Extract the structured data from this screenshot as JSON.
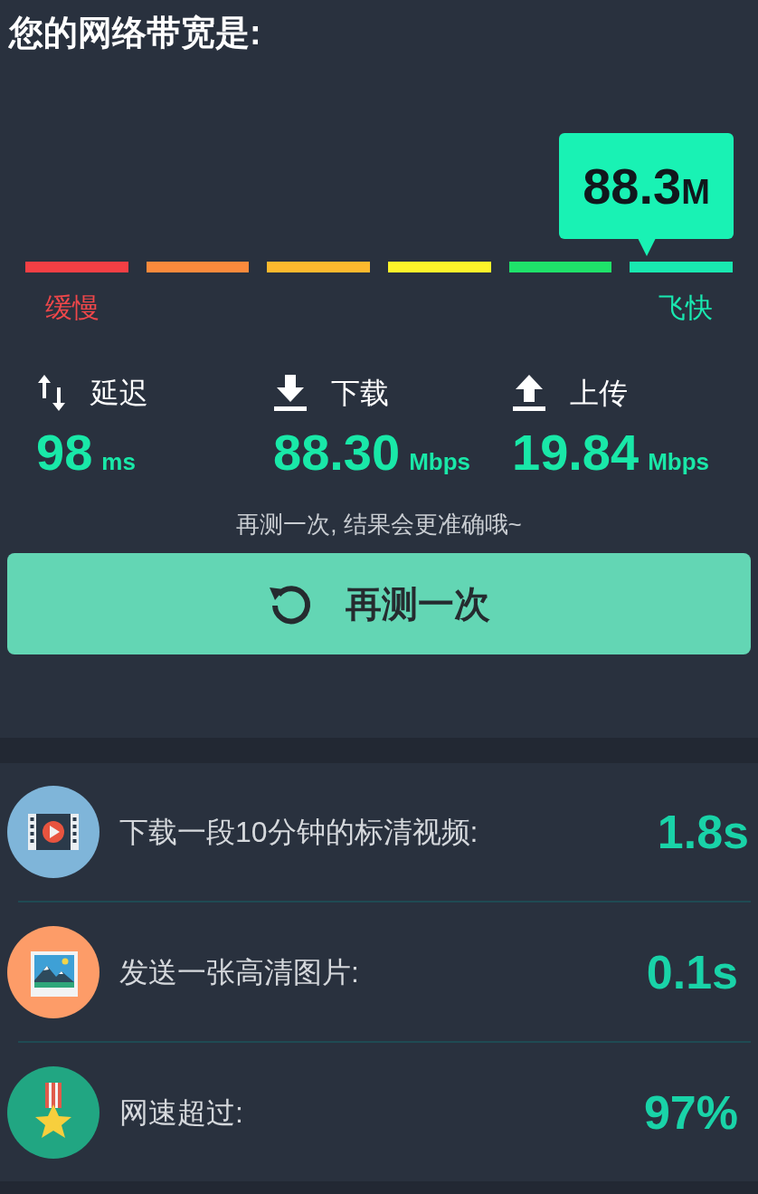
{
  "title": "您的网络带宽是:",
  "gauge": {
    "reading": "88.3",
    "unit": "M",
    "slow_label": "缓慢",
    "fast_label": "飞快",
    "segments": [
      {
        "color": "#f43f44",
        "selected": false
      },
      {
        "color": "#fb8a3c",
        "selected": false
      },
      {
        "color": "#fdb92e",
        "selected": false
      },
      {
        "color": "#fdf32a",
        "selected": false
      },
      {
        "color": "#1fe26a",
        "selected": false
      },
      {
        "color": "#19e8b0",
        "selected": true
      }
    ]
  },
  "stats": [
    {
      "kind": "latency",
      "label": "延迟",
      "value": "98",
      "unit": "ms"
    },
    {
      "kind": "download",
      "label": "下载",
      "value": "88.30",
      "unit": "Mbps"
    },
    {
      "kind": "upload",
      "label": "上传",
      "value": "19.84",
      "unit": "Mbps"
    }
  ],
  "hint": "再测一次, 结果会更准确哦~",
  "retest_button": "再测一次",
  "results": [
    {
      "kind": "video",
      "label": "下载一段10分钟的标清视频:",
      "value": "1.8s"
    },
    {
      "kind": "image",
      "label": "发送一张高清图片:",
      "value": "0.1s"
    },
    {
      "kind": "medal",
      "label": "网速超过:",
      "value": "97%"
    }
  ]
}
